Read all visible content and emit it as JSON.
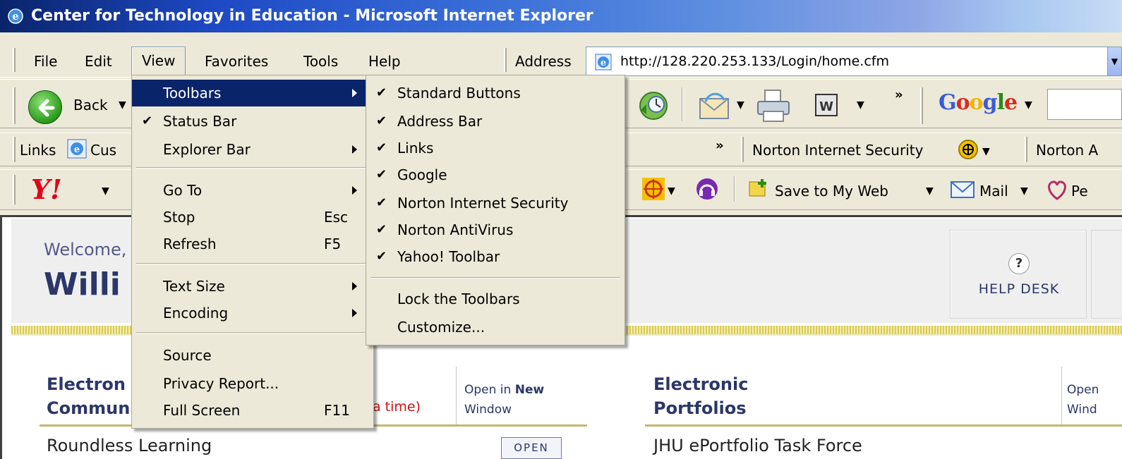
{
  "window": {
    "title": "Center for Technology in Education - Microsoft Internet Explorer"
  },
  "menubar": {
    "items": [
      "File",
      "Edit",
      "View",
      "Favorites",
      "Tools",
      "Help"
    ],
    "address_label": "Address",
    "url": "http://128.220.253.133/Login/home.cfm"
  },
  "toolbar": {
    "back_label": "Back",
    "google_label": "Google",
    "chevron": "»"
  },
  "links_bar": {
    "links_label": "Links",
    "custom_link": "Cus",
    "chevron": "»",
    "norton_is": "Norton Internet Security",
    "norton_av": "Norton A"
  },
  "yahoo_bar": {
    "save_label": "Save to My Web",
    "mail_label": "Mail",
    "pe_label": "Pe"
  },
  "view_menu": {
    "items": [
      {
        "label": "Toolbars",
        "submenu": true,
        "highlighted": true
      },
      {
        "label": "Status Bar",
        "checked": true
      },
      {
        "label": "Explorer Bar",
        "submenu": true
      },
      {
        "label": "Go To",
        "submenu": true
      },
      {
        "label": "Stop",
        "shortcut": "Esc"
      },
      {
        "label": "Refresh",
        "shortcut": "F5"
      },
      {
        "label": "Text Size",
        "submenu": true
      },
      {
        "label": "Encoding",
        "submenu": true
      },
      {
        "label": "Source"
      },
      {
        "label": "Privacy Report..."
      },
      {
        "label": "Full Screen",
        "shortcut": "F11"
      }
    ]
  },
  "toolbars_menu": {
    "items": [
      {
        "label": "Standard Buttons",
        "checked": true
      },
      {
        "label": "Address Bar",
        "checked": true
      },
      {
        "label": "Links",
        "checked": true
      },
      {
        "label": "Google",
        "checked": true
      },
      {
        "label": "Norton Internet Security",
        "checked": true
      },
      {
        "label": "Norton AntiVirus",
        "checked": true
      },
      {
        "label": "Yahoo! Toolbar",
        "checked": true
      },
      {
        "label": "Lock the Toolbars"
      },
      {
        "label": "Customize..."
      }
    ]
  },
  "page": {
    "welcome": "Welcome,",
    "username": "Willi",
    "help_desk": "HELP DESK",
    "left_section": {
      "title_line1": "Electron",
      "title_line2": "Commun",
      "note": "a time)",
      "open_new": "Open in",
      "open_new_bold": "New",
      "open_window": "Window"
    },
    "right_section": {
      "title_line1": "Electronic",
      "title_line2": "Portfolios",
      "open_new": "Open",
      "open_window": "Wind"
    },
    "left_row": "Roundless Learning",
    "right_row": "JHU ePortfolio Task Force",
    "open_button": "OPEN"
  },
  "colors": {
    "menu_highlight": "#0a246a",
    "chrome": "#ECE9D8",
    "brand_navy": "#2c3768",
    "note_red": "#cc1111"
  }
}
